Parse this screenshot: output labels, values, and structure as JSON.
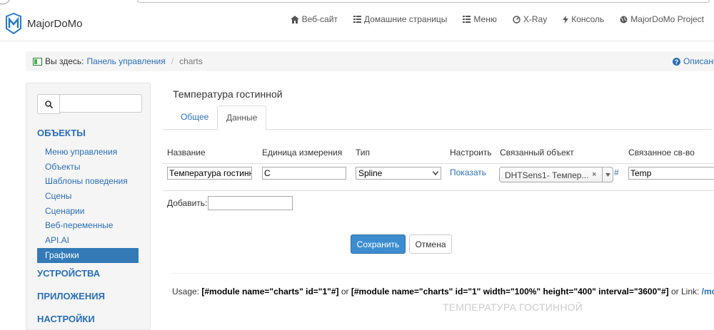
{
  "brand": {
    "name": "MajorDoMo"
  },
  "nav": [
    {
      "label": "Веб-сайт",
      "icon": "home-icon"
    },
    {
      "label": "Домашние страницы",
      "icon": "list-icon"
    },
    {
      "label": "Меню",
      "icon": "list-icon"
    },
    {
      "label": "X-Ray",
      "icon": "dashboard-icon"
    },
    {
      "label": "Консоль",
      "icon": "flash-icon"
    },
    {
      "label": "MajorDoMo Project",
      "icon": "globe-icon"
    }
  ],
  "breadcrumb": {
    "here": "Вы здесь:",
    "parent": "Панель управления",
    "separator": "/",
    "current": "charts",
    "help": "Описание моду"
  },
  "sidebar": {
    "search_value": "",
    "sections": [
      "ОБЪЕКТЫ",
      "УСТРОЙСТВА",
      "ПРИЛОЖЕНИЯ",
      "НАСТРОЙКИ"
    ],
    "items": [
      "Меню управления",
      "Объекты",
      "Шаблоны поведения",
      "Сцены",
      "Сценарии",
      "Веб-переменные",
      "API.AI",
      "Графики"
    ],
    "active_item": "Графики"
  },
  "page": {
    "title": "Температура гостинной",
    "tabs": [
      "Общее",
      "Данные"
    ],
    "active_tab": "Данные"
  },
  "table": {
    "headers": [
      "Название",
      "Единица измерения",
      "Тип",
      "Настроить",
      "Связанный объект",
      "Связанное св-во"
    ],
    "row": {
      "name": "Температура гостинн",
      "unit": "C",
      "type": "Spline",
      "configure": "Показать",
      "linked_object": "DHTSens1- Темпер...",
      "clear": "×",
      "hash": "#",
      "linked_property": "Temp"
    }
  },
  "add": {
    "label": "Добавить:",
    "value": ""
  },
  "buttons": {
    "save": "Сохранить",
    "cancel": "Отмена"
  },
  "usage": {
    "prefix": "Usage:",
    "code1": "[#module name=\"charts\" id=\"1\"#]",
    "or": "or",
    "code2": "[#module name=\"charts\" id=\"1\" width=\"100%\" height=\"400\" interval=\"3600\"#]",
    "or_link": "or Link:",
    "link": "/module/c"
  },
  "chart_preview_title": "ТЕМПЕРАТУРА ГОСТИННОЙ",
  "colors": {
    "accent": "#2a6fb6",
    "active_bg": "#337ab7",
    "save_btn": "#3c8dcf"
  }
}
